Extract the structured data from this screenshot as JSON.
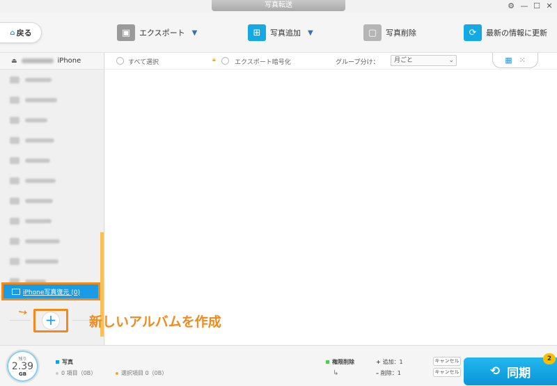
{
  "window": {
    "title": "写真転送"
  },
  "toolbar": {
    "back_label": "戻る",
    "export_label": "エクスポート",
    "add_photo_label": "写真追加",
    "delete_photo_label": "写真削除",
    "refresh_label": "最新の情報に更新"
  },
  "sidebar": {
    "device_name": "iPhone",
    "album_count_blurred": 11,
    "selected_album": "iPhone写真復元 (0)"
  },
  "main": {
    "select_all": "すべて選択",
    "export_encrypt": "エクスポート暗号化",
    "group_label": "グループ分け：",
    "group_value": "月ごと"
  },
  "annotation": {
    "text": "新しいアルバムを作成"
  },
  "bottom": {
    "storage_remaining_label": "残り",
    "storage_value": "2.39",
    "storage_unit": "GB",
    "category_label": "写真",
    "items_label": "0 項目（0B）",
    "selected_label": "選択項目 0（0B）",
    "sync_mode_label": "権限削除",
    "add_label": "追加：1",
    "delete_label": "削除：1",
    "cancel_label": "キャンセル",
    "sync_label": "同期",
    "sync_badge": "2"
  },
  "colors": {
    "accent": "#1a9be6",
    "highlight": "#f08a1a",
    "sync": "#14a9e3",
    "badge": "#f6c000"
  }
}
